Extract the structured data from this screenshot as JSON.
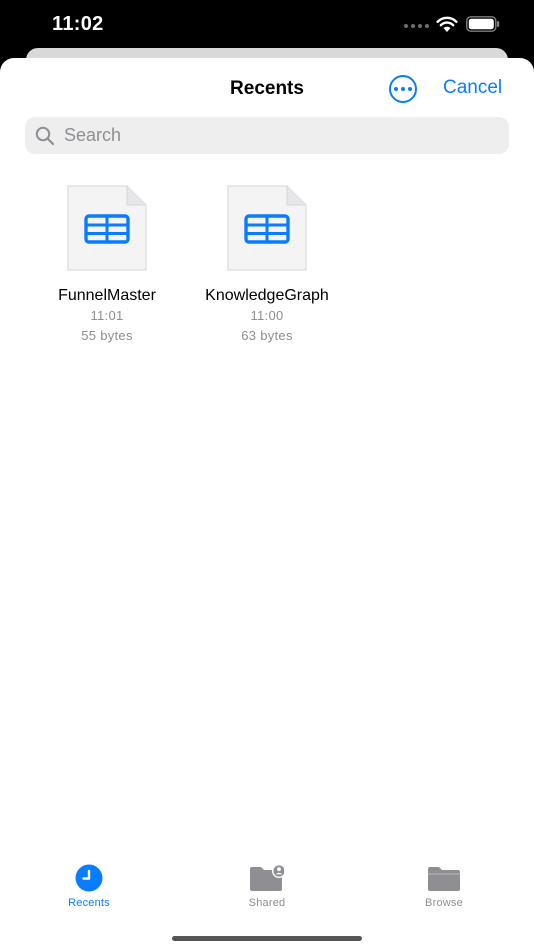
{
  "status_bar": {
    "time": "11:02"
  },
  "nav": {
    "title": "Recents",
    "cancel_label": "Cancel"
  },
  "search": {
    "placeholder": "Search",
    "value": ""
  },
  "files": [
    {
      "name": "FunnelMaster",
      "time": "11:01",
      "size": "55 bytes",
      "icon": "spreadsheet-icon"
    },
    {
      "name": "KnowledgeGraph",
      "time": "11:00",
      "size": "63 bytes",
      "icon": "spreadsheet-icon"
    }
  ],
  "tabs": [
    {
      "label": "Recents",
      "icon": "clock-icon",
      "active": true
    },
    {
      "label": "Shared",
      "icon": "shared-folder-icon",
      "active": false
    },
    {
      "label": "Browse",
      "icon": "folder-icon",
      "active": false
    }
  ],
  "colors": {
    "accent": "#0a7cff",
    "secondary_text": "#8e8e93",
    "search_bg": "#eeeeef"
  }
}
